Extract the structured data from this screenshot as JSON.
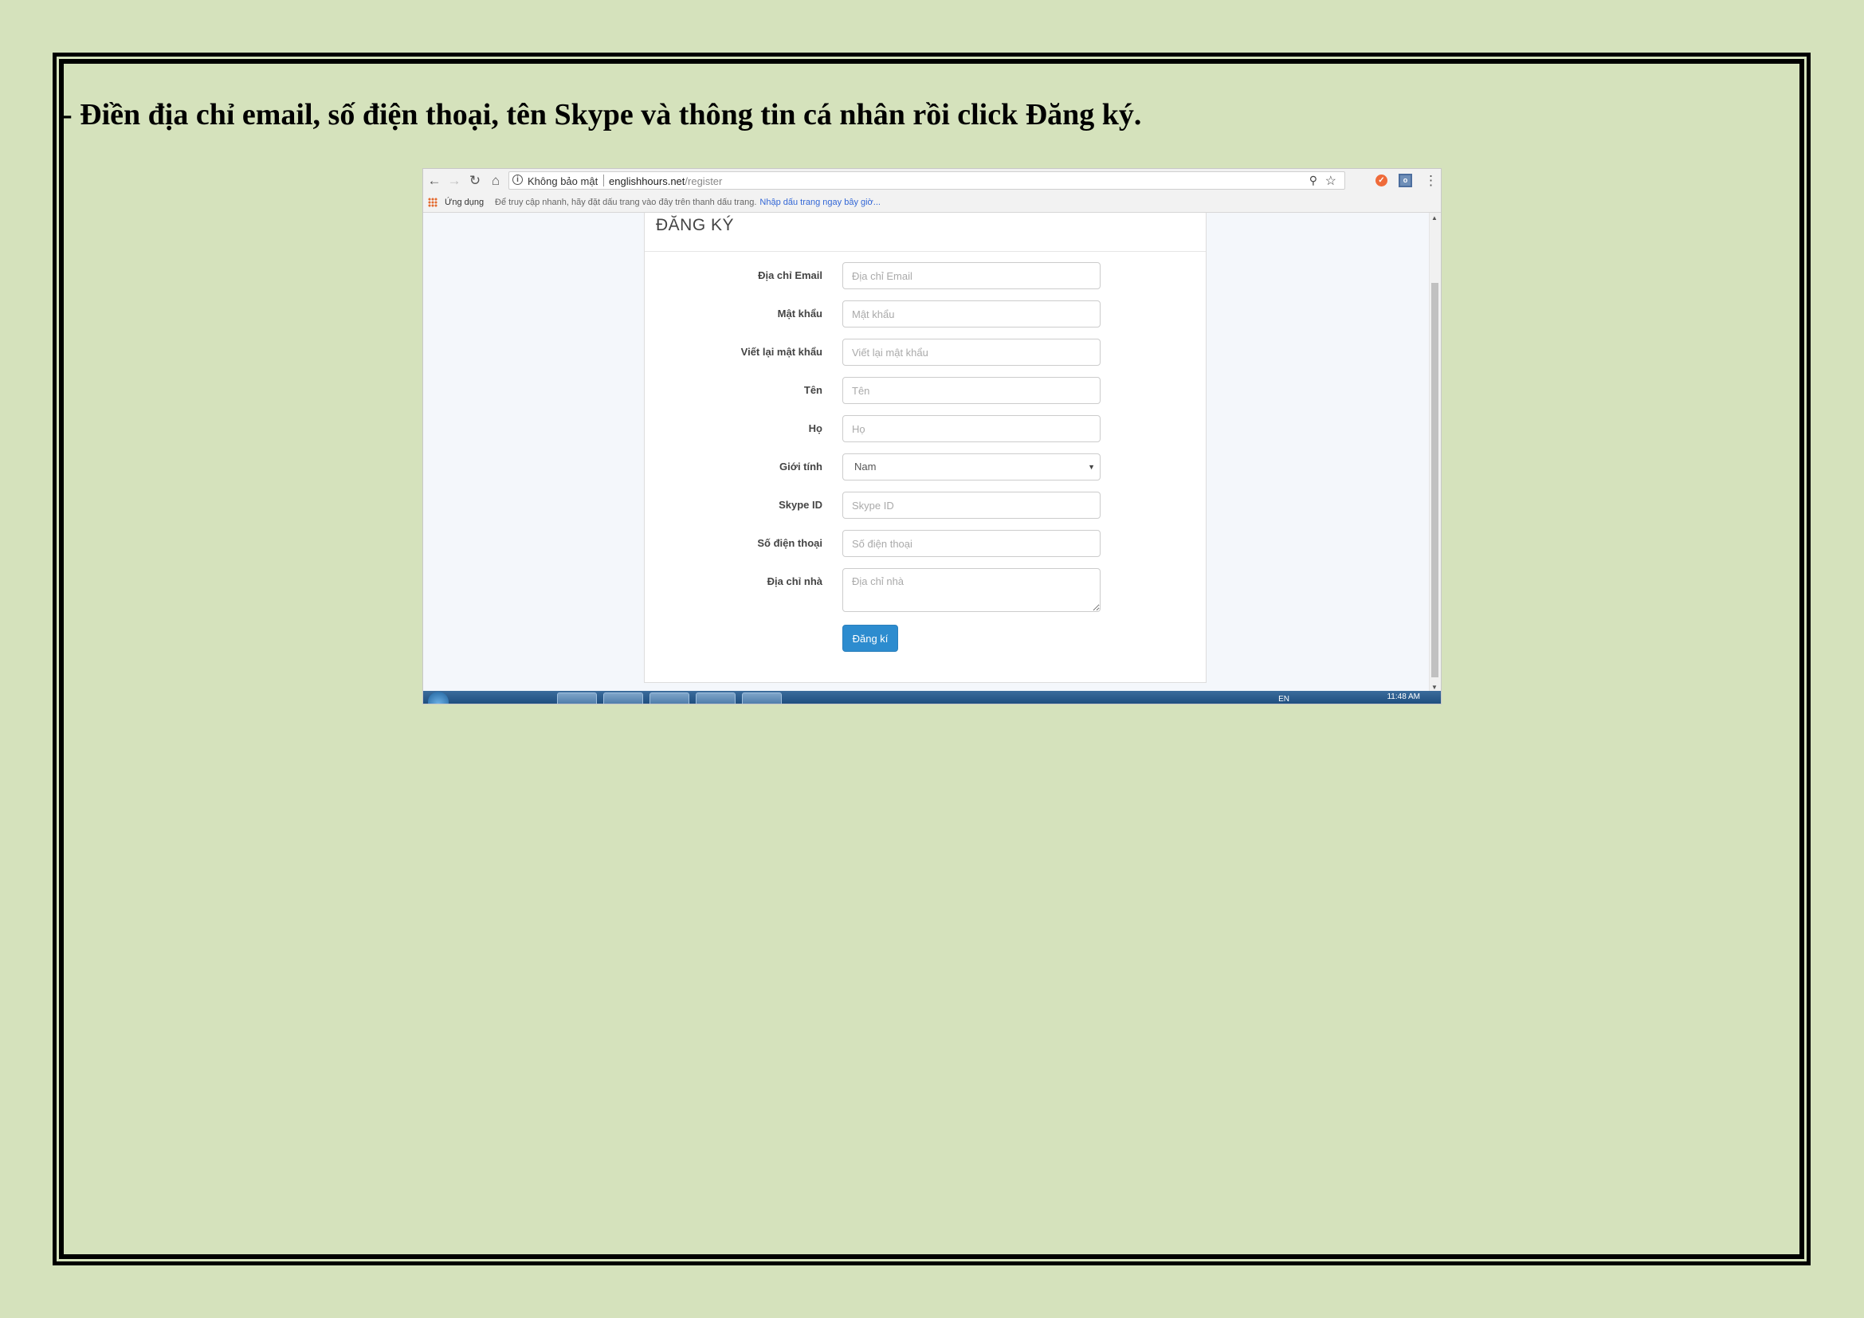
{
  "document": {
    "instruction": "- Điền địa chỉ email, số điện thoại, tên Skype và thông tin cá nhân rồi click Đăng ký."
  },
  "browser": {
    "security_label": "Không bảo mật",
    "url_host": "englishhours.net",
    "url_path": "/register",
    "bookmarks": {
      "apps_label": "Ứng dụng",
      "hint": "Để truy cập nhanh, hãy đặt dấu trang vào đây trên thanh dấu trang.",
      "import_link": "Nhập dấu trang ngay bây giờ..."
    }
  },
  "form": {
    "title": "ĐĂNG KÝ",
    "fields": [
      {
        "label": "Địa chỉ Email",
        "placeholder": "Địa chỉ Email"
      },
      {
        "label": "Mật khẩu",
        "placeholder": "Mật khẩu"
      },
      {
        "label": "Viết lại mật khẩu",
        "placeholder": "Viết lại mật khẩu"
      },
      {
        "label": "Tên",
        "placeholder": "Tên"
      },
      {
        "label": "Họ",
        "placeholder": "Họ"
      },
      {
        "label": "Giới tính",
        "value": "Nam"
      },
      {
        "label": "Skype ID",
        "placeholder": "Skype ID"
      },
      {
        "label": "Số điện thoại",
        "placeholder": "Số điện thoại"
      },
      {
        "label": "Địa chỉ nhà",
        "placeholder": "Địa chỉ nhà"
      }
    ],
    "submit_label": "Đăng kí"
  },
  "taskbar": {
    "clock": "11:48 AM",
    "language": "EN"
  },
  "icons": [
    "back-arrow-icon",
    "forward-arrow-icon",
    "reload-icon",
    "home-icon",
    "info-icon",
    "key-icon",
    "star-icon",
    "extension-icon",
    "menu-icon",
    "apps-grid-icon",
    "chevron-down-icon",
    "windows-start-icon"
  ]
}
